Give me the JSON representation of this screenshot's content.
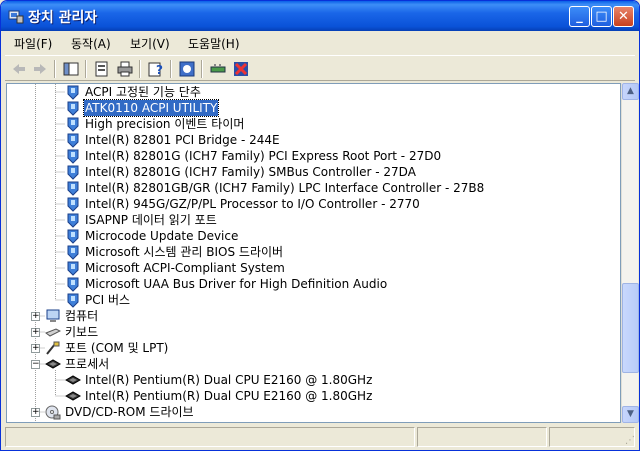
{
  "window": {
    "title": "장치 관리자",
    "colors": {
      "titlebar": "#0a52d8",
      "selection": "#316ac5"
    }
  },
  "menu": [
    {
      "label": "파일(F)"
    },
    {
      "label": "동작(A)"
    },
    {
      "label": "보기(V)"
    },
    {
      "label": "도움말(H)"
    }
  ],
  "toolbar": {
    "icons": [
      "back-icon",
      "forward-icon",
      "tree-view-icon",
      "properties-icon",
      "print-icon",
      "help-icon",
      "scan-hardware-icon",
      "update-driver-icon",
      "uninstall-icon"
    ]
  },
  "tree": {
    "system_devices": [
      {
        "label": "ACPI 고정된 기능 단추"
      },
      {
        "label": "ATK0110 ACPI UTILITY",
        "selected": true
      },
      {
        "label": "High precision 이벤트 타이머"
      },
      {
        "label": "Intel(R) 82801 PCI Bridge - 244E"
      },
      {
        "label": "Intel(R) 82801G (ICH7 Family) PCI Express Root Port - 27D0"
      },
      {
        "label": "Intel(R) 82801G (ICH7 Family) SMBus Controller - 27DA"
      },
      {
        "label": "Intel(R) 82801GB/GR (ICH7 Family) LPC Interface Controller - 27B8"
      },
      {
        "label": "Intel(R) 945G/GZ/P/PL Processor to I/O Controller - 2770"
      },
      {
        "label": "ISAPNP 데이터 읽기 포트"
      },
      {
        "label": "Microcode Update Device"
      },
      {
        "label": "Microsoft 시스템 관리 BIOS 드라이버"
      },
      {
        "label": "Microsoft ACPI-Compliant System"
      },
      {
        "label": "Microsoft UAA Bus Driver for High Definition Audio"
      },
      {
        "label": "PCI 버스"
      }
    ],
    "categories_top": [
      {
        "label": "컴퓨터",
        "expander": "+"
      },
      {
        "label": "키보드",
        "expander": "+"
      },
      {
        "label": "포트 (COM 및 LPT)",
        "expander": "+"
      },
      {
        "label": "프로세서",
        "expander": "−"
      }
    ],
    "processors": [
      {
        "label": "Intel(R) Pentium(R) Dual  CPU  E2160  @ 1.80GHz"
      },
      {
        "label": "Intel(R) Pentium(R) Dual  CPU  E2160  @ 1.80GHz"
      }
    ],
    "categories_bottom": [
      {
        "label": "DVD/CD-ROM 드라이브",
        "expander": "+"
      }
    ]
  }
}
